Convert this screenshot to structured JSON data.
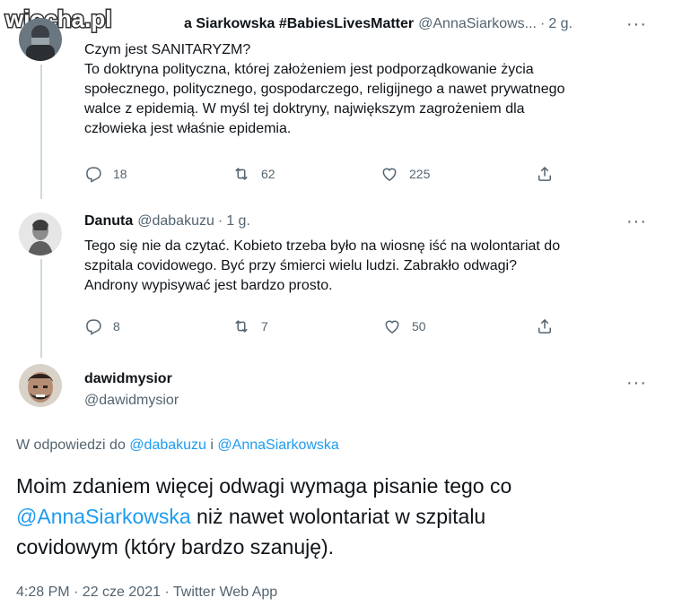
{
  "watermark": {
    "text": "wiocha.pl"
  },
  "tweet1": {
    "name_visible": "a Siarkowska #BabiesLivesMatter",
    "handle": "@AnnaSiarkows...",
    "separator": "·",
    "time": "2 g.",
    "lines": [
      "Czym jest SANITARYZM?",
      "To doktryna polityczna, której założeniem jest podporządkowanie życia",
      "społecznego, politycznego, gospodarczego, religijnego a nawet prywatnego",
      "walce z epidemią. W myśl tej doktryny, największym zagrożeniem dla",
      "człowieka jest właśnie epidemia."
    ],
    "replies": "18",
    "retweets": "62",
    "likes": "225"
  },
  "tweet2": {
    "name": "Danuta",
    "handle": "@dabakuzu",
    "separator": "·",
    "time": "1 g.",
    "lines": [
      "Tego się nie da czytać. Kobieto trzeba było na wiosnę iść na wolontariat do",
      "szpitala covidowego. Być przy śmierci wielu ludzi. Zabrakło odwagi?",
      "Androny wypisywać jest bardzo prosto."
    ],
    "replies": "8",
    "retweets": "7",
    "likes": "50"
  },
  "main_tweet": {
    "name": "dawidmysior",
    "handle": "@dawidmysior",
    "reply_prefix": "W odpowiedzi do",
    "reply_user1": "@dabakuzu",
    "reply_and": "i",
    "reply_user2": "@AnnaSiarkowska",
    "text_line1": "Moim zdaniem więcej odwagi wymaga pisanie tego co",
    "mention": "@AnnaSiarkowska",
    "text_line2_rest": " niż nawet wolontariat w szpitalu",
    "text_line3": "covidowym (który bardzo szanuję).",
    "timestamp": "4:28 PM · 22 cze 2021 · Twitter Web App"
  },
  "icons": {
    "reply": "reply-icon",
    "retweet": "retweet-icon",
    "like": "like-icon",
    "share": "share-icon",
    "more": "more-icon"
  },
  "colors": {
    "link": "#1d9bf0",
    "secondary_text": "#536471",
    "thread_line": "#cfd9de"
  }
}
